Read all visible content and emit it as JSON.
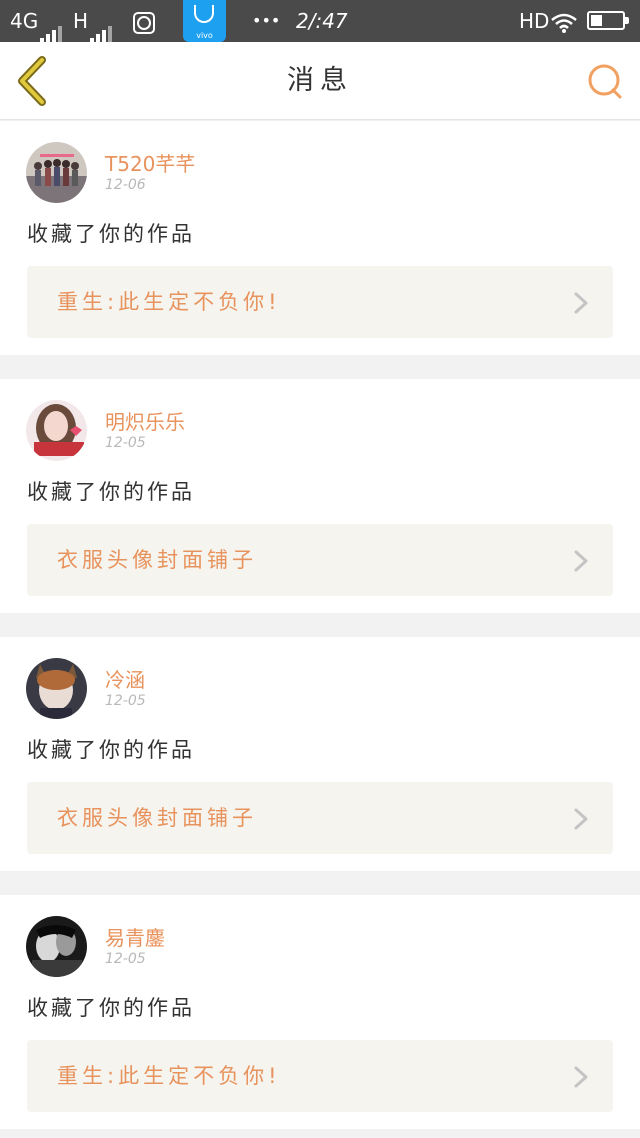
{
  "status_bar": {
    "network": "4G",
    "network2": "H",
    "time": "2/:47",
    "hd": "HD",
    "app_brand": "vivo",
    "dots": "•••",
    "battery_level": 0.35
  },
  "header": {
    "title": "消息",
    "back_icon": "chevron-left-icon",
    "search_icon": "search-icon"
  },
  "colors": {
    "accent": "#e8935d",
    "back_icon": "#d9c13a",
    "search_icon": "#f0a060"
  },
  "messages": [
    {
      "username": "T520芊芊",
      "date": "12-06",
      "action": "收藏了你的作品",
      "work_title": "重生:此生定不负你!"
    },
    {
      "username": "明炽乐乐",
      "date": "12-05",
      "action": "收藏了你的作品",
      "work_title": "衣服头像封面铺子"
    },
    {
      "username": "冷涵",
      "date": "12-05",
      "action": "收藏了你的作品",
      "work_title": "衣服头像封面铺子"
    },
    {
      "username": "易青鏖",
      "date": "12-05",
      "action": "收藏了你的作品",
      "work_title": "重生:此生定不负你!"
    }
  ]
}
